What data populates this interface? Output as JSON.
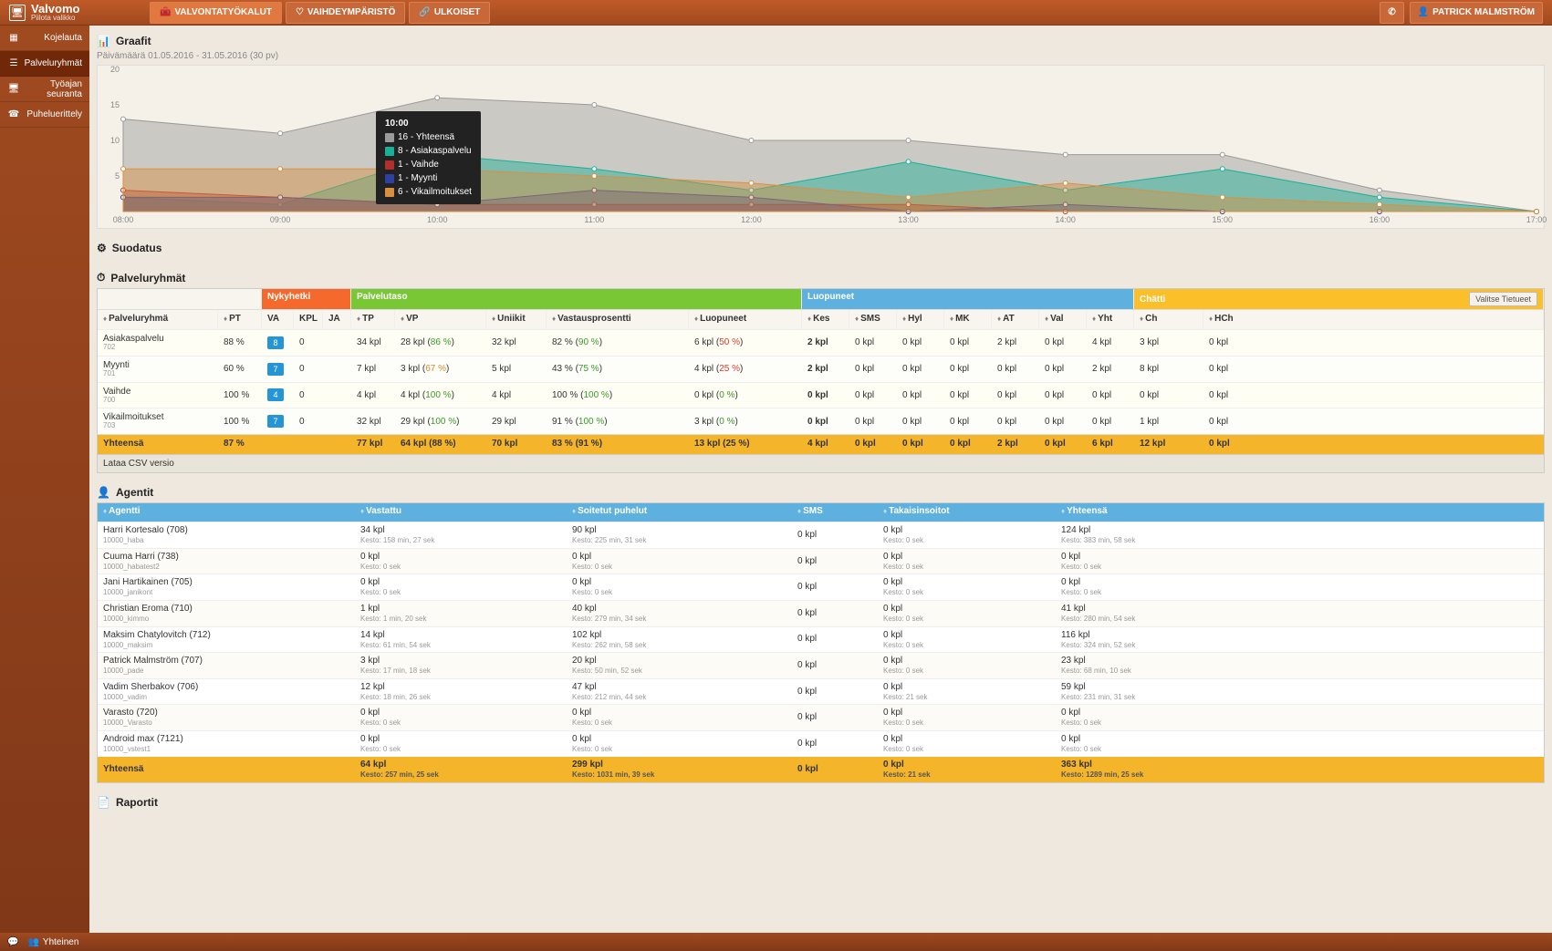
{
  "app": {
    "title": "Valvomo",
    "subtitle": "Piilota valikko"
  },
  "topTabs": [
    {
      "label": "VALVONTATYÖKALUT"
    },
    {
      "label": "VAIHDEYMPÄRISTÖ"
    },
    {
      "label": "ULKOISET"
    }
  ],
  "user": {
    "name": "PATRICK MALMSTRÖM"
  },
  "sidebar": {
    "items": [
      {
        "icon": "grid",
        "label": "Kojelauta"
      },
      {
        "icon": "list",
        "label": "Palveluryhmät"
      },
      {
        "icon": "monitor",
        "label": "Työajan seuranta"
      },
      {
        "icon": "phone",
        "label": "Puheluerittely"
      }
    ]
  },
  "panels": {
    "graafit": {
      "title": "Graafit",
      "subtitle": "Päivämäärä 01.05.2016 - 31.05.2016 (30 pv)"
    },
    "suodatus": {
      "title": "Suodatus"
    },
    "palveluryhmat": {
      "title": "Palveluryhmät"
    },
    "agentit": {
      "title": "Agentit"
    },
    "raportit": {
      "title": "Raportit"
    }
  },
  "chart_data": {
    "type": "area",
    "xlabel": "",
    "ylabel": "",
    "ylim": [
      0,
      20
    ],
    "yticks": [
      5,
      10,
      15,
      20
    ],
    "x": [
      "08:00",
      "09:00",
      "10:00",
      "11:00",
      "12:00",
      "13:00",
      "14:00",
      "15:00",
      "16:00",
      "17:00"
    ],
    "series": [
      {
        "name": "Yhteensä",
        "color": "#9a9a9a",
        "values": [
          13,
          11,
          16,
          15,
          10,
          10,
          8,
          8,
          3,
          0
        ]
      },
      {
        "name": "Asiakaspalvelu",
        "color": "#18b096",
        "values": [
          2,
          1,
          8,
          6,
          3,
          7,
          3,
          6,
          2,
          0
        ]
      },
      {
        "name": "Vaihde",
        "color": "#b03030",
        "values": [
          3,
          2,
          1,
          1,
          1,
          1,
          0,
          0,
          0,
          0
        ]
      },
      {
        "name": "Myynti",
        "color": "#3040a0",
        "values": [
          2,
          2,
          1,
          3,
          2,
          0,
          1,
          0,
          0,
          0
        ]
      },
      {
        "name": "Vikailmoitukset",
        "color": "#d89040",
        "values": [
          6,
          6,
          6,
          5,
          4,
          2,
          4,
          2,
          1,
          0
        ]
      }
    ],
    "tooltip": {
      "time": "10:00",
      "rows": [
        {
          "color": "#9a9a9a",
          "text": "16 - Yhteensä"
        },
        {
          "color": "#18b096",
          "text": "8 - Asiakaspalvelu"
        },
        {
          "color": "#b03030",
          "text": "1 - Vaihde"
        },
        {
          "color": "#3040a0",
          "text": "1 - Myynti"
        },
        {
          "color": "#d89040",
          "text": "6 - Vikailmoitukset"
        }
      ]
    }
  },
  "groupTable": {
    "headerGroups": {
      "nykyhetki": "Nykyhetki",
      "palvelutaso": "Palvelutaso",
      "luopuneet": "Luopuneet",
      "chatti": "Chätti",
      "valitse": "Valitse Tietueet"
    },
    "cols": {
      "name": "Palveluryhmä",
      "pt": "PT",
      "va": "VA",
      "kpl": "KPL",
      "ja": "JA",
      "tp": "TP",
      "vp": "VP",
      "uni": "Uniikit",
      "vast": "Vastausprosentti",
      "luop": "Luopuneet",
      "kes": "Kes",
      "sms": "SMS",
      "hyl": "Hyl",
      "mk": "MK",
      "at": "AT",
      "val": "Val",
      "yht": "Yht",
      "ch": "Ch",
      "hch": "HCh"
    },
    "rows": [
      {
        "name": "Asiakaspalvelu",
        "sub": "702",
        "pt": "88 %",
        "va": "8",
        "vaColor": "#2695d6",
        "kpl": "0",
        "ja": "",
        "tp": "34 kpl",
        "vp": "28 kpl",
        "vpPct": "86 %",
        "vpPctClass": "pct-green",
        "uni": "32 kpl",
        "vast1": "82 %",
        "vast2": "90 %",
        "vast2Class": "pct-green",
        "luop": "6 kpl",
        "luopPct": "50 %",
        "luopClass": "pct-red",
        "kes": "2 kpl",
        "sms": "0 kpl",
        "hyl": "0 kpl",
        "mk": "0 kpl",
        "at": "2 kpl",
        "val": "0 kpl",
        "yht": "4 kpl",
        "ch": "3 kpl",
        "hch": "0 kpl"
      },
      {
        "name": "Myynti",
        "sub": "701",
        "pt": "60 %",
        "va": "7",
        "vaColor": "#2695d6",
        "kpl": "0",
        "ja": "",
        "tp": "7 kpl",
        "vp": "3 kpl",
        "vpPct": "67 %",
        "vpPctClass": "pct-orange",
        "uni": "5 kpl",
        "vast1": "43 %",
        "vast2": "75 %",
        "vast2Class": "pct-green",
        "luop": "4 kpl",
        "luopPct": "25 %",
        "luopClass": "pct-red",
        "kes": "2 kpl",
        "sms": "0 kpl",
        "hyl": "0 kpl",
        "mk": "0 kpl",
        "at": "0 kpl",
        "val": "0 kpl",
        "yht": "2 kpl",
        "ch": "8 kpl",
        "hch": "0 kpl"
      },
      {
        "name": "Vaihde",
        "sub": "700",
        "pt": "100 %",
        "va": "4",
        "vaColor": "#2695d6",
        "kpl": "0",
        "ja": "",
        "tp": "4 kpl",
        "vp": "4 kpl",
        "vpPct": "100 %",
        "vpPctClass": "pct-green",
        "uni": "4 kpl",
        "vast1": "100 %",
        "vast2": "100 %",
        "vast2Class": "pct-green",
        "luop": "0 kpl",
        "luopPct": "0 %",
        "luopClass": "pct-green",
        "kes": "0 kpl",
        "sms": "0 kpl",
        "hyl": "0 kpl",
        "mk": "0 kpl",
        "at": "0 kpl",
        "val": "0 kpl",
        "yht": "0 kpl",
        "ch": "0 kpl",
        "hch": "0 kpl"
      },
      {
        "name": "Vikailmoitukset",
        "sub": "703",
        "pt": "100 %",
        "va": "7",
        "vaColor": "#2695d6",
        "kpl": "0",
        "ja": "",
        "tp": "32 kpl",
        "vp": "29 kpl",
        "vpPct": "100 %",
        "vpPctClass": "pct-green",
        "uni": "29 kpl",
        "vast1": "91 %",
        "vast2": "100 %",
        "vast2Class": "pct-green",
        "luop": "3 kpl",
        "luopPct": "0 %",
        "luopClass": "pct-green",
        "kes": "0 kpl",
        "sms": "0 kpl",
        "hyl": "0 kpl",
        "mk": "0 kpl",
        "at": "0 kpl",
        "val": "0 kpl",
        "yht": "0 kpl",
        "ch": "1 kpl",
        "hch": "0 kpl"
      }
    ],
    "total": {
      "name": "Yhteensä",
      "pt": "87 %",
      "tp": "77 kpl",
      "vp": "64 kpl (88 %)",
      "uni": "70 kpl",
      "vast": "83 % (91 %)",
      "luop": "13 kpl (25 %)",
      "kes": "4 kpl",
      "sms": "0 kpl",
      "hyl": "0 kpl",
      "mk": "0 kpl",
      "at": "2 kpl",
      "val": "0 kpl",
      "yht": "6 kpl",
      "ch": "12 kpl",
      "hch": "0 kpl"
    },
    "csv": "Lataa CSV versio"
  },
  "agentTable": {
    "cols": {
      "name": "Agentti",
      "vast": "Vastattu",
      "soit": "Soitetut puhelut",
      "sms": "SMS",
      "tak": "Takaisinsoitot",
      "yht": "Yhteensä"
    },
    "rows": [
      {
        "name": "Harri Kortesalo (708)",
        "sub": "10000_haba",
        "vast": "34 kpl",
        "vastSub": "Kesto: 158 min, 27 sek",
        "soit": "90 kpl",
        "soitSub": "Kesto: 225 min, 31 sek",
        "sms": "0 kpl",
        "tak": "0 kpl",
        "takSub": "Kesto: 0 sek",
        "yht": "124 kpl",
        "yhtSub": "Kesto: 383 min, 58 sek"
      },
      {
        "name": "Cuuma Harri (738)",
        "sub": "10000_habatest2",
        "vast": "0 kpl",
        "vastSub": "Kesto: 0 sek",
        "soit": "0 kpl",
        "soitSub": "Kesto: 0 sek",
        "sms": "0 kpl",
        "tak": "0 kpl",
        "takSub": "Kesto: 0 sek",
        "yht": "0 kpl",
        "yhtSub": "Kesto: 0 sek"
      },
      {
        "name": "Jani Hartikainen (705)",
        "sub": "10000_janikont",
        "vast": "0 kpl",
        "vastSub": "Kesto: 0 sek",
        "soit": "0 kpl",
        "soitSub": "Kesto: 0 sek",
        "sms": "0 kpl",
        "tak": "0 kpl",
        "takSub": "Kesto: 0 sek",
        "yht": "0 kpl",
        "yhtSub": "Kesto: 0 sek"
      },
      {
        "name": "Christian Eroma (710)",
        "sub": "10000_kimmo",
        "vast": "1 kpl",
        "vastSub": "Kesto: 1 min, 20 sek",
        "soit": "40 kpl",
        "soitSub": "Kesto: 279 min, 34 sek",
        "sms": "0 kpl",
        "tak": "0 kpl",
        "takSub": "Kesto: 0 sek",
        "yht": "41 kpl",
        "yhtSub": "Kesto: 280 min, 54 sek"
      },
      {
        "name": "Maksim Chatylovitch (712)",
        "sub": "10000_maksim",
        "vast": "14 kpl",
        "vastSub": "Kesto: 61 min, 54 sek",
        "soit": "102 kpl",
        "soitSub": "Kesto: 262 min, 58 sek",
        "sms": "0 kpl",
        "tak": "0 kpl",
        "takSub": "Kesto: 0 sek",
        "yht": "116 kpl",
        "yhtSub": "Kesto: 324 min, 52 sek"
      },
      {
        "name": "Patrick Malmström (707)",
        "sub": "10000_pade",
        "vast": "3 kpl",
        "vastSub": "Kesto: 17 min, 18 sek",
        "soit": "20 kpl",
        "soitSub": "Kesto: 50 min, 52 sek",
        "sms": "0 kpl",
        "tak": "0 kpl",
        "takSub": "Kesto: 0 sek",
        "yht": "23 kpl",
        "yhtSub": "Kesto: 68 min, 10 sek"
      },
      {
        "name": "Vadim Sherbakov (706)",
        "sub": "10000_vadim",
        "vast": "12 kpl",
        "vastSub": "Kesto: 18 min, 26 sek",
        "soit": "47 kpl",
        "soitSub": "Kesto: 212 min, 44 sek",
        "sms": "0 kpl",
        "tak": "0 kpl",
        "takSub": "Kesto: 21 sek",
        "yht": "59 kpl",
        "yhtSub": "Kesto: 231 min, 31 sek"
      },
      {
        "name": "Varasto (720)",
        "sub": "10000_Varasto",
        "vast": "0 kpl",
        "vastSub": "Kesto: 0 sek",
        "soit": "0 kpl",
        "soitSub": "Kesto: 0 sek",
        "sms": "0 kpl",
        "tak": "0 kpl",
        "takSub": "Kesto: 0 sek",
        "yht": "0 kpl",
        "yhtSub": "Kesto: 0 sek"
      },
      {
        "name": "Android max (7121)",
        "sub": "10000_vstest1",
        "vast": "0 kpl",
        "vastSub": "Kesto: 0 sek",
        "soit": "0 kpl",
        "soitSub": "Kesto: 0 sek",
        "sms": "0 kpl",
        "tak": "0 kpl",
        "takSub": "Kesto: 0 sek",
        "yht": "0 kpl",
        "yhtSub": "Kesto: 0 sek"
      }
    ],
    "total": {
      "name": "Yhteensä",
      "vast": "64 kpl",
      "vastSub": "Kesto: 257 min, 25 sek",
      "soit": "299 kpl",
      "soitSub": "Kesto: 1031 min, 39 sek",
      "sms": "0 kpl",
      "tak": "0 kpl",
      "takSub": "Kesto: 21 sek",
      "yht": "363 kpl",
      "yhtSub": "Kesto: 1289 min, 25 sek"
    }
  },
  "bottom": {
    "chat": "",
    "yhteinen": "Yhteinen"
  }
}
